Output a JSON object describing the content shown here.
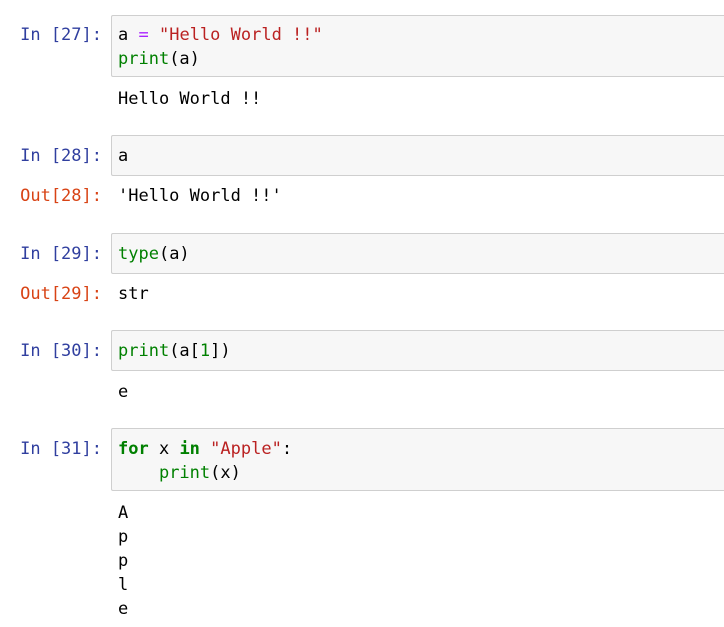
{
  "cells": [
    {
      "in_prompt": "In [27]:",
      "code": [
        [
          {
            "t": "a ",
            "c": ""
          },
          {
            "t": "=",
            "c": "op"
          },
          {
            "t": " ",
            "c": ""
          },
          {
            "t": "\"Hello World !!\"",
            "c": "str"
          }
        ],
        [
          {
            "t": "print",
            "c": "builtin"
          },
          {
            "t": "(a)",
            "c": ""
          }
        ]
      ],
      "out_prompt": "",
      "output": [
        "Hello World !!"
      ]
    },
    {
      "in_prompt": "In [28]:",
      "code": [
        [
          {
            "t": "a",
            "c": ""
          }
        ]
      ],
      "out_prompt": "Out[28]:",
      "output": [
        "'Hello World !!'"
      ]
    },
    {
      "in_prompt": "In [29]:",
      "code": [
        [
          {
            "t": "type",
            "c": "builtin"
          },
          {
            "t": "(a)",
            "c": ""
          }
        ]
      ],
      "out_prompt": "Out[29]:",
      "output": [
        "str"
      ]
    },
    {
      "in_prompt": "In [30]:",
      "code": [
        [
          {
            "t": "print",
            "c": "builtin"
          },
          {
            "t": "(a[",
            "c": ""
          },
          {
            "t": "1",
            "c": "num"
          },
          {
            "t": "])",
            "c": ""
          }
        ]
      ],
      "out_prompt": "",
      "output": [
        "e"
      ]
    },
    {
      "in_prompt": "In [31]:",
      "code": [
        [
          {
            "t": "for",
            "c": "kw"
          },
          {
            "t": " x ",
            "c": ""
          },
          {
            "t": "in",
            "c": "kw"
          },
          {
            "t": " ",
            "c": ""
          },
          {
            "t": "\"Apple\"",
            "c": "str"
          },
          {
            "t": ":",
            "c": ""
          }
        ],
        [
          {
            "t": "    ",
            "c": ""
          },
          {
            "t": "print",
            "c": "builtin"
          },
          {
            "t": "(x)",
            "c": ""
          }
        ]
      ],
      "out_prompt": "",
      "output": [
        "A",
        "p",
        "p",
        "l",
        "e"
      ]
    }
  ],
  "colors": {
    "in_prompt": "#303f9f",
    "out_prompt": "#d84315",
    "string": "#ba2121",
    "operator": "#aa22ff",
    "builtin": "#008000",
    "keyword": "#008000",
    "number": "#008000",
    "cell_bg": "#f7f7f7",
    "cell_border": "#cfcfcf"
  }
}
